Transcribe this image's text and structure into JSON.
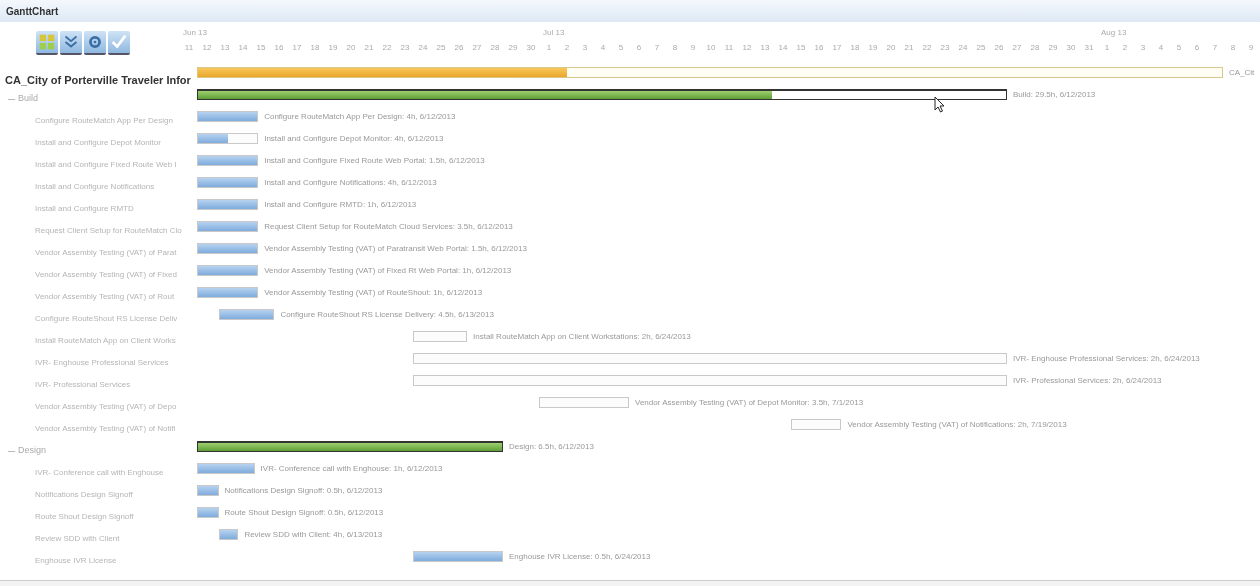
{
  "window": {
    "title": "GanttChart"
  },
  "toolbar": [
    {
      "kind": "expand"
    },
    {
      "kind": "collapse"
    },
    {
      "kind": "settings"
    },
    {
      "kind": "check"
    }
  ],
  "tree": {
    "title": "CA_City of Porterville Traveler Infor",
    "items": [
      {
        "label": "Build",
        "expanded": true,
        "children": [
          {
            "label": "Configure RouteMatch App Per Design"
          },
          {
            "label": "Install and Configure Depot Monitor"
          },
          {
            "label": "Install and Configure Fixed Route Web I"
          },
          {
            "label": "Install and Configure Notifications"
          },
          {
            "label": "Install and Configure RMTD"
          },
          {
            "label": "Request Client Setup for RouteMatch Clo"
          },
          {
            "label": "Vendor Assembly Testing (VAT) of Parat"
          },
          {
            "label": "Vendor Assembly Testing (VAT) of Fixed"
          },
          {
            "label": "Vendor Assembly Testing (VAT) of Rout"
          },
          {
            "label": "Configure RouteShout RS License Deliv"
          },
          {
            "label": "Install RouteMatch App on Client Works"
          },
          {
            "label": "IVR- Enghouse Professional Services"
          },
          {
            "label": "IVR- Professional Services"
          },
          {
            "label": "Vendor Assembly Testing (VAT) of Depo"
          },
          {
            "label": "Vendor Assembly Testing (VAT) of Notifi"
          }
        ]
      },
      {
        "label": "Design",
        "expanded": true,
        "children": [
          {
            "label": "IVR- Conference call with Enghouse"
          },
          {
            "label": "Notifications Design Signoff"
          },
          {
            "label": "Route Shout Design Signoff"
          },
          {
            "label": "Review SDD with Client"
          },
          {
            "label": "Enghouse IVR License"
          }
        ]
      }
    ]
  },
  "timeline": {
    "months": [
      {
        "label": "Jun 13",
        "days": [
          "11",
          "12",
          "13",
          "14",
          "15",
          "16",
          "17",
          "18",
          "19",
          "20",
          "21",
          "22",
          "23",
          "24",
          "25",
          "26",
          "27",
          "28",
          "29",
          "30"
        ]
      },
      {
        "label": "Jul 13",
        "days": [
          "1",
          "2",
          "3",
          "4",
          "5",
          "6",
          "7",
          "8",
          "9",
          "10",
          "11",
          "12",
          "13",
          "14",
          "15",
          "16",
          "17",
          "18",
          "19",
          "20",
          "21",
          "22",
          "23",
          "24",
          "25",
          "26",
          "27",
          "28",
          "29",
          "30",
          "31"
        ]
      },
      {
        "label": "Aug 13",
        "days": [
          "1",
          "2",
          "3",
          "4",
          "5",
          "6",
          "7",
          "8",
          "9"
        ]
      }
    ]
  },
  "bars": [
    {
      "kind": "project",
      "level": 0.36,
      "label": "CA_Cit"
    },
    {
      "kind": "summary",
      "level": 0.71,
      "label": "Build: 29.5h, 6/12/2013"
    },
    {
      "kind": "task",
      "level": 1,
      "label": "Configure RouteMatch App Per Design: 4h, 6/12/2013"
    },
    {
      "kind": "task",
      "level": 0.5,
      "label": "Install and Configure Depot Monitor: 4h, 6/12/2013"
    },
    {
      "kind": "task",
      "level": 1,
      "label": "Install and Configure Fixed Route Web Portal: 1.5h, 6/12/2013"
    },
    {
      "kind": "task",
      "level": 1,
      "label": "Install and Configure Notifications: 4h, 6/12/2013"
    },
    {
      "kind": "task",
      "level": 1,
      "label": "Install and Configure RMTD: 1h, 6/12/2013"
    },
    {
      "kind": "task",
      "level": 1,
      "label": "Request Client Setup for RouteMatch Cloud Services: 3.5h, 6/12/2013"
    },
    {
      "kind": "task",
      "level": 1,
      "label": "Vendor Assembly Testing (VAT) of Paratransit Web Portal: 1.5h, 6/12/2013"
    },
    {
      "kind": "task",
      "level": 1,
      "label": "Vendor Assembly Testing (VAT) of Fixed Rt Web Portal: 1h, 6/12/2013"
    },
    {
      "kind": "task",
      "level": 1,
      "label": "Vendor Assembly Testing (VAT) of RouteShout: 1h, 6/12/2013"
    },
    {
      "kind": "task",
      "level": 1,
      "label": "Configure RouteShout RS License Delivery: 4.5h, 6/13/2013"
    },
    {
      "kind": "task",
      "label": "Install RouteMatch App on Client Workstations: 2h, 6/24/2013"
    },
    {
      "kind": "task",
      "label": "IVR- Enghouse Professional Services: 2h, 6/24/2013"
    },
    {
      "kind": "task",
      "label": "IVR- Professional Services: 2h, 6/24/2013"
    },
    {
      "kind": "task",
      "label": "Vendor Assembly Testing (VAT) of Depot Monitor: 3.5h, 7/1/2013"
    },
    {
      "kind": "task",
      "label": "Vendor Assembly Testing (VAT) of Notifications: 2h, 7/19/2013"
    },
    {
      "kind": "summary",
      "level": 1,
      "label": "Design: 6.5h, 6/12/2013"
    },
    {
      "kind": "task",
      "level": 1,
      "label": "IVR- Conference call with Enghouse: 1h, 6/12/2013"
    },
    {
      "kind": "task",
      "level": 1,
      "label": "Notifications Design Signoff: 0.5h, 6/12/2013"
    },
    {
      "kind": "task",
      "level": 1,
      "label": "Route Shout Design Signoff: 0.5h, 6/12/2013"
    },
    {
      "kind": "task",
      "level": 1,
      "label": "Review SDD with Client: 4h, 6/13/2013"
    },
    {
      "kind": "task",
      "level": 1,
      "label": "Enghouse IVR License: 0.5h, 6/24/2013"
    }
  ]
}
